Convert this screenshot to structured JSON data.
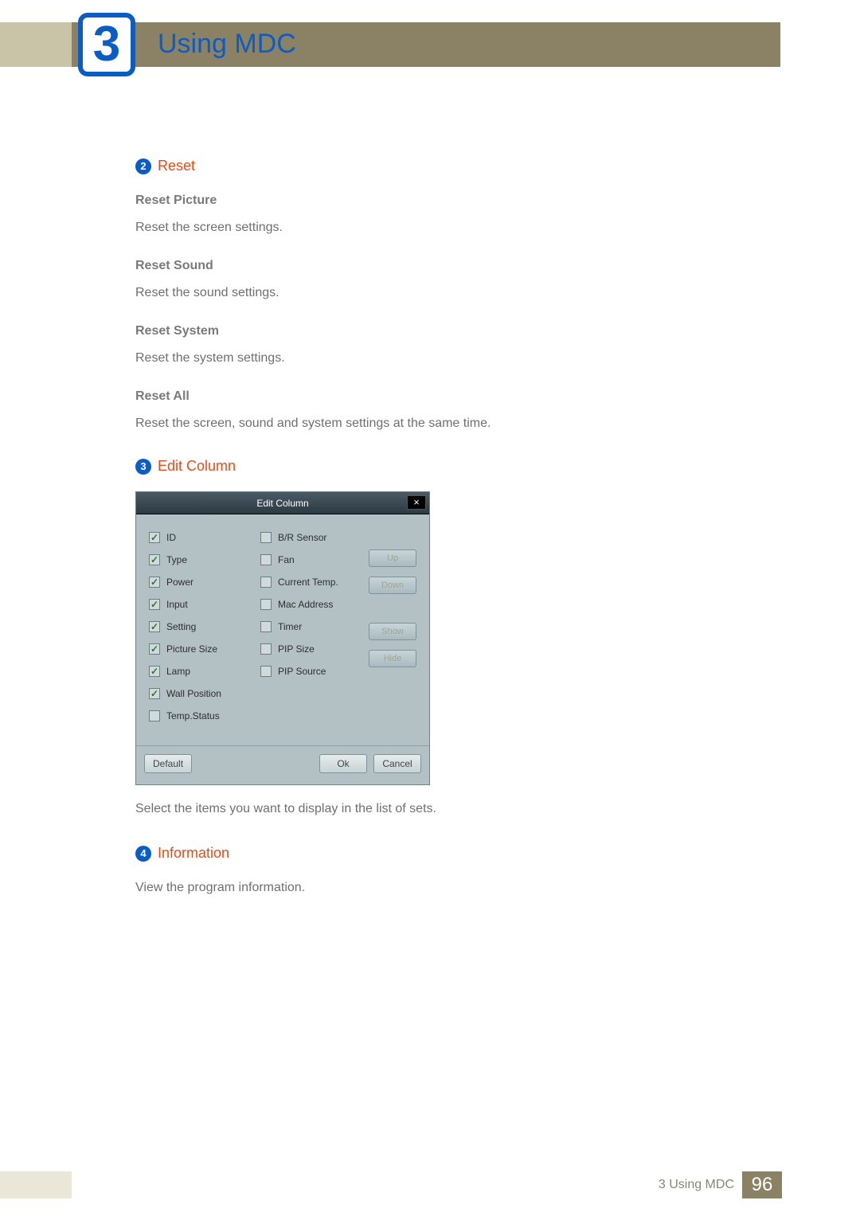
{
  "chapter": {
    "number": "3",
    "title": "Using MDC"
  },
  "sections": {
    "reset": {
      "num": "2",
      "heading": "Reset",
      "items": [
        {
          "h": "Reset Picture",
          "p": "Reset the screen settings."
        },
        {
          "h": "Reset Sound",
          "p": "Reset the sound settings."
        },
        {
          "h": "Reset System",
          "p": "Reset the system settings."
        },
        {
          "h": "Reset All",
          "p": "Reset the screen, sound and system settings at the same time."
        }
      ]
    },
    "editcol": {
      "num": "3",
      "heading": "Edit Column",
      "caption": "Select the items you want to display in the list of sets."
    },
    "info": {
      "num": "4",
      "heading": "Information",
      "caption": "View the program information."
    }
  },
  "dialog": {
    "title": "Edit Column",
    "close": "×",
    "col1": [
      {
        "label": "ID",
        "checked": true
      },
      {
        "label": "Type",
        "checked": true
      },
      {
        "label": "Power",
        "checked": true
      },
      {
        "label": "Input",
        "checked": true
      },
      {
        "label": "Setting",
        "checked": true
      },
      {
        "label": "Picture Size",
        "checked": true
      },
      {
        "label": "Lamp",
        "checked": true
      },
      {
        "label": "Wall Position",
        "checked": true
      },
      {
        "label": "Temp.Status",
        "checked": false
      }
    ],
    "col2": [
      {
        "label": "B/R Sensor",
        "checked": false
      },
      {
        "label": "Fan",
        "checked": false
      },
      {
        "label": "Current Temp.",
        "checked": false
      },
      {
        "label": "Mac Address",
        "checked": false
      },
      {
        "label": "Timer",
        "checked": false
      },
      {
        "label": "PIP Size",
        "checked": false
      },
      {
        "label": "PIP Source",
        "checked": false
      }
    ],
    "buttons": {
      "up": "Up",
      "down": "Down",
      "show": "Show",
      "hide": "Hide"
    },
    "footer": {
      "default": "Default",
      "ok": "Ok",
      "cancel": "Cancel"
    }
  },
  "footer": {
    "label": "3 Using MDC",
    "page": "96"
  }
}
